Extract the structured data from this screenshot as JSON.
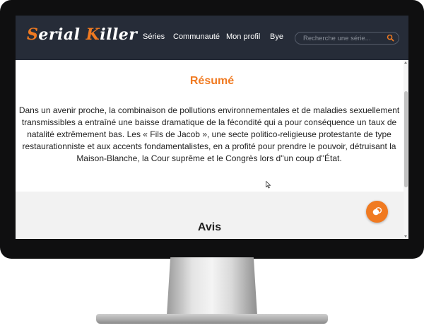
{
  "brand": {
    "part1": "S",
    "part2": "erial ",
    "part3": "K",
    "part4": "iller"
  },
  "nav": {
    "links": [
      "Séries",
      "Communauté",
      "Mon profil",
      "Bye"
    ],
    "search_placeholder": "Recherche une série...",
    "search_icon": "search-icon"
  },
  "resume": {
    "title": "Résumé",
    "text": "Dans un avenir proche, la combinaison de pollutions environnementales et de maladies sexuellement transmissibles a entraîné une baisse dramatique de la fécondité qui a pour conséquence un taux de natalité extrêmement bas. Les « Fils de Jacob », une secte politico-religieuse protestante de type restaurationniste et aux accents fondamentalistes, en a profité pour prendre le pouvoir, détruisant la Maison-Blanche, la Cour suprême et le Congrès lors d''un coup d''État."
  },
  "avis": {
    "title": "Avis"
  },
  "colors": {
    "accent": "#f07a21",
    "navbar": "#262c38",
    "section_bg": "#f2f2f2"
  },
  "icons": {
    "chat": "chat-icon",
    "cursor": "mouse-cursor-icon"
  }
}
